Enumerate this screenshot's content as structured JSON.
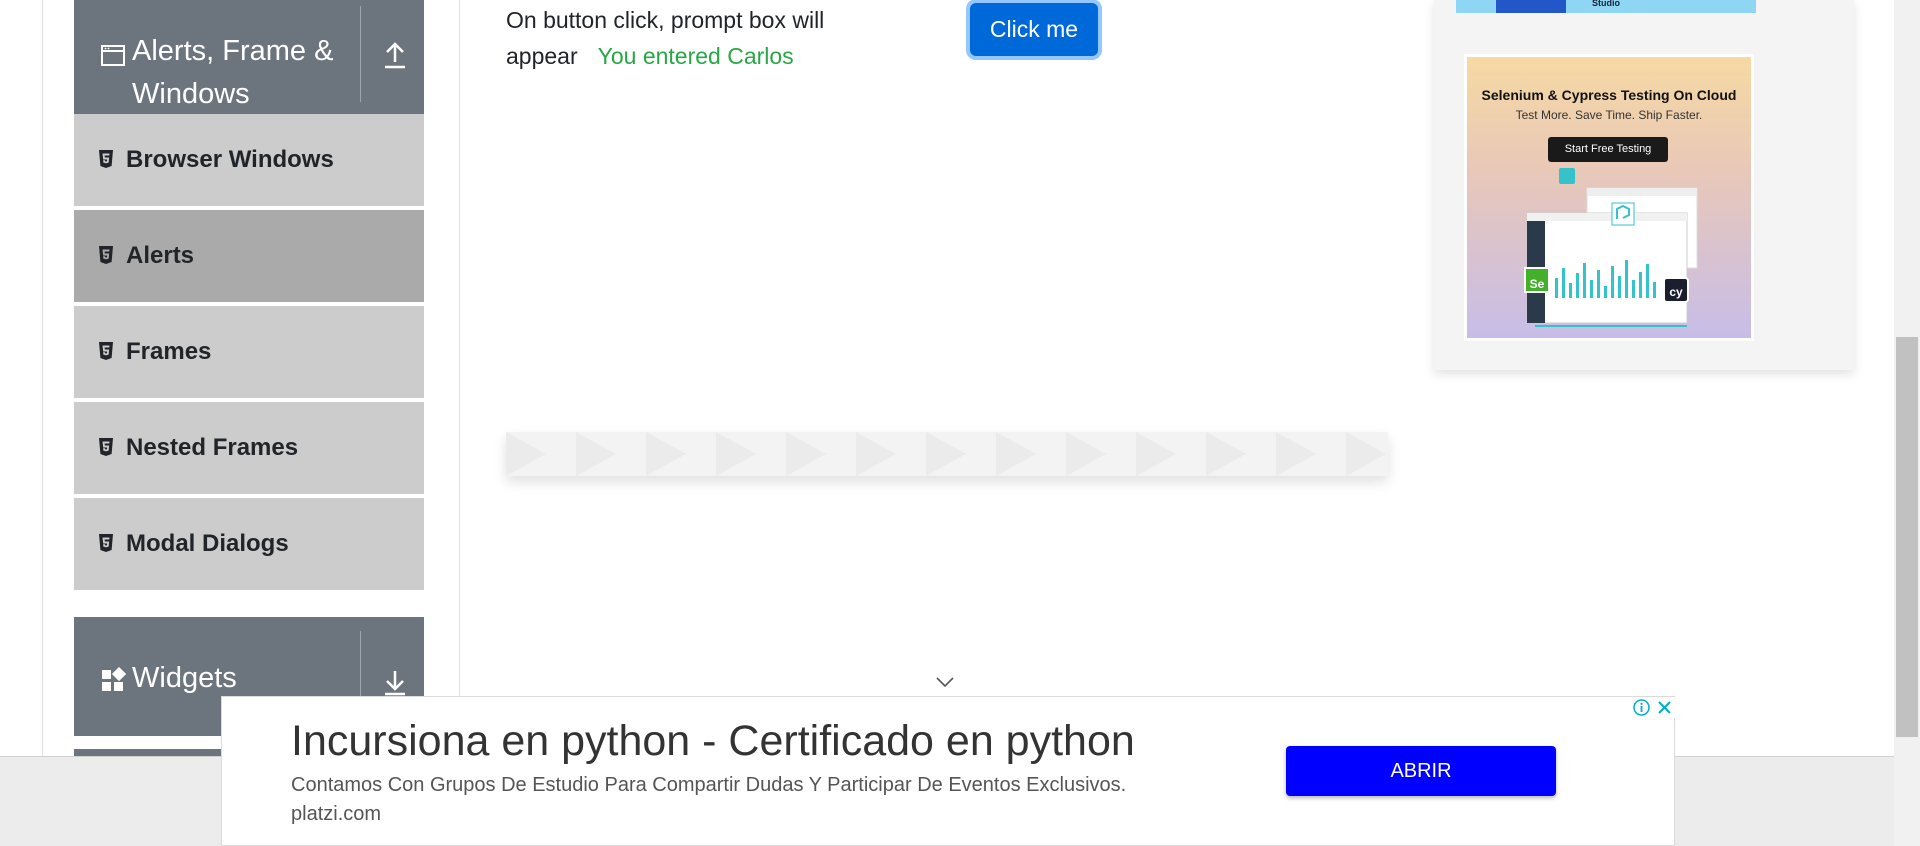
{
  "sidebar": {
    "alerts_group": {
      "title": "Alerts, Frame & Windows",
      "icon": "window-icon",
      "toggle_icon": "collapse-arrow-up-icon"
    },
    "items": [
      {
        "label": "Browser Windows",
        "icon": "html5-icon",
        "active": false
      },
      {
        "label": "Alerts",
        "icon": "html5-icon",
        "active": true
      },
      {
        "label": "Frames",
        "icon": "html5-icon",
        "active": false
      },
      {
        "label": "Nested Frames",
        "icon": "html5-icon",
        "active": false
      },
      {
        "label": "Modal Dialogs",
        "icon": "html5-icon",
        "active": false
      }
    ],
    "widgets_group": {
      "title": "Widgets",
      "icon": "grid-icon",
      "toggle_icon": "expand-arrow-down-icon"
    }
  },
  "main": {
    "prompt": {
      "text": "On button click, prompt box will appear",
      "result": "You entered Carlos",
      "button_label": "Click me"
    }
  },
  "right_ad": {
    "top_banner_text": "Studio",
    "headline": "Selenium & Cypress Testing On Cloud",
    "subtext": "Test More. Save Time. Ship Faster.",
    "cta_label": "Start Free Testing",
    "badges": [
      "Se",
      "cy"
    ]
  },
  "bottom_ad": {
    "headline": "Incursiona en python - Certificado en python",
    "description": "Contamos Con Grupos De Estudio Para Compartir Dudas Y Participar De Eventos Exclusivos.",
    "domain": "platzi.com",
    "button_label": "ABRIR"
  },
  "colors": {
    "sidebar_header": "#6c757d",
    "menu_item": "#cccccc",
    "menu_item_active": "#aaaaaa",
    "primary_button": "#0069d9",
    "success_text": "#28a745",
    "ad_button": "#0000ff"
  }
}
